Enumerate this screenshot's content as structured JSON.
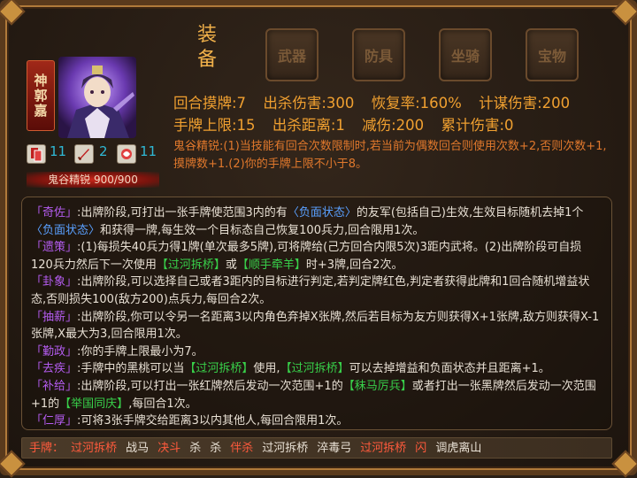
{
  "general": {
    "name": "神郭嘉"
  },
  "counters": [
    {
      "icon": "card-icon",
      "value": "11"
    },
    {
      "icon": "sword-icon",
      "value": "2"
    },
    {
      "icon": "rage-icon",
      "value": "11"
    }
  ],
  "resource": {
    "label": "鬼谷精锐 900/900"
  },
  "equipment": {
    "label": "装备",
    "slots": [
      "武器",
      "防具",
      "坐骑",
      "宝物"
    ]
  },
  "stats": {
    "row1": [
      "回合摸牌:7",
      "出杀伤害:300",
      "恢复率:160%",
      "计谋伤害:200"
    ],
    "row2": [
      "手牌上限:15",
      "出杀距离:1",
      "减伤:200",
      "累计伤害:0"
    ]
  },
  "passive": "鬼谷精锐:(1)当技能有回合次数限制时,若当前为偶数回合则使用次数+2,否则次数+1,摸牌数+1.(2)你的手牌上限不小于8。",
  "skills": [
    {
      "name": "「奇佐」",
      "parts": [
        {
          "t": ":出牌阶段,可打出一张手牌使范围3内的有",
          "c": ""
        },
        {
          "t": "〈负面状态〉",
          "c": "blue"
        },
        {
          "t": "的友军(包括自己)生效,生效目标随机去掉1个",
          "c": ""
        },
        {
          "t": "〈负面状态〉",
          "c": "blue"
        },
        {
          "t": "和获得一牌,每生效一个目标态自己恢复100兵力,回合限用1次。",
          "c": ""
        }
      ]
    },
    {
      "name": "「遗策」",
      "parts": [
        {
          "t": ":(1)每损失40兵力得1牌(单次最多5牌),可将牌给(己方回合内限5次)3距内武将。(2)出牌阶段可自损120兵力然后下一次使用",
          "c": ""
        },
        {
          "t": "【过河拆桥】",
          "c": "green"
        },
        {
          "t": "或",
          "c": ""
        },
        {
          "t": "【顺手牵羊】",
          "c": "green"
        },
        {
          "t": "时+3牌,回合2次。",
          "c": ""
        }
      ]
    },
    {
      "name": "「卦象」",
      "parts": [
        {
          "t": ":出牌阶段,可以选择自己或者3距内的目标进行判定,若判定牌红色,判定者获得此牌和1回合随机增益状态,否则损失100(敌方200)点兵力,每回合2次。",
          "c": ""
        }
      ]
    },
    {
      "name": "「抽薪」",
      "parts": [
        {
          "t": ":出牌阶段,你可以令另一名距离3以内角色弃掉X张牌,然后若目标为友方则获得X+1张牌,敌方则获得X-1张牌,X最大为3,回合限用1次。",
          "c": ""
        }
      ]
    },
    {
      "name": "「勤政」",
      "parts": [
        {
          "t": ":你的手牌上限最小为7。",
          "c": ""
        }
      ]
    },
    {
      "name": "「去疾」",
      "parts": [
        {
          "t": ":手牌中的黑桃可以当",
          "c": ""
        },
        {
          "t": "【过河拆桥】",
          "c": "green"
        },
        {
          "t": "使用,",
          "c": ""
        },
        {
          "t": "【过河拆桥】",
          "c": "green"
        },
        {
          "t": "可以去掉增益和负面状态并且距离+1。",
          "c": ""
        }
      ]
    },
    {
      "name": "「补给」",
      "parts": [
        {
          "t": ":出牌阶段,可以打出一张红牌然后发动一次范围+1的",
          "c": ""
        },
        {
          "t": "【秣马厉兵】",
          "c": "green"
        },
        {
          "t": "或者打出一张黑牌然后发动一次范围+1的",
          "c": ""
        },
        {
          "t": "【举国同庆】",
          "c": "green"
        },
        {
          "t": ",每回合1次。",
          "c": ""
        }
      ]
    },
    {
      "name": "「仁厚」",
      "parts": [
        {
          "t": ":可将3张手牌交给距离3以内其他人,每回合限用1次。",
          "c": ""
        }
      ]
    }
  ],
  "hand": {
    "label": "手牌：",
    "cards": [
      {
        "name": "过河拆桥",
        "color": "red"
      },
      {
        "name": "战马",
        "color": "white"
      },
      {
        "name": "决斗",
        "color": "red"
      },
      {
        "name": "杀",
        "color": "white"
      },
      {
        "name": "杀",
        "color": "white"
      },
      {
        "name": "伴杀",
        "color": "red"
      },
      {
        "name": "过河拆桥",
        "color": "white"
      },
      {
        "name": "淬毒弓",
        "color": "white"
      },
      {
        "name": "过河拆桥",
        "color": "red"
      },
      {
        "name": "闪",
        "color": "red"
      },
      {
        "name": "调虎离山",
        "color": "white"
      }
    ]
  }
}
